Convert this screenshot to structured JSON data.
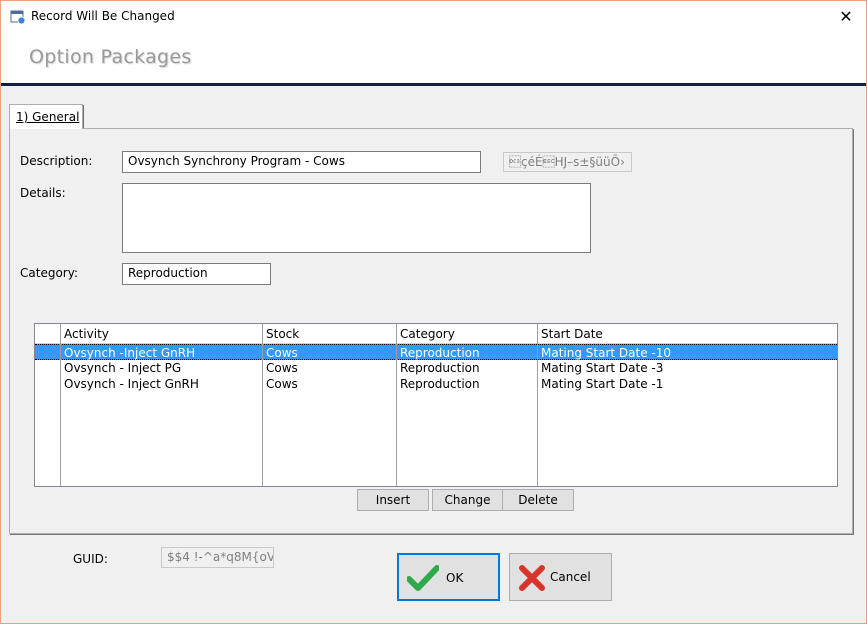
{
  "window": {
    "title": "Record Will Be Changed"
  },
  "header": {
    "title": "Option Packages"
  },
  "tabs": [
    {
      "label": "1) General"
    }
  ],
  "form": {
    "description_label": "Description:",
    "description_value": "Ovsynch Synchrony Program - Cows",
    "code_value": "\u0013çéÉ\u001bHJ–s±§üüÕ›",
    "details_label": "Details:",
    "details_value": "",
    "category_label": "Category:",
    "category_value": "Reproduction"
  },
  "grid": {
    "columns": [
      "Activity",
      "Stock",
      "Category",
      "Start Date"
    ],
    "rows": [
      {
        "activity": "Ovsynch -Inject GnRH",
        "stock": "Cows",
        "category": "Reproduction",
        "start": "Mating Start Date -10",
        "selected": true
      },
      {
        "activity": "Ovsynch - Inject PG",
        "stock": "Cows",
        "category": "Reproduction",
        "start": "Mating Start Date -3",
        "selected": false
      },
      {
        "activity": "Ovsynch - Inject GnRH",
        "stock": "Cows",
        "category": "Reproduction",
        "start": "Mating Start Date -1",
        "selected": false
      }
    ]
  },
  "grid_buttons": {
    "insert": "Insert",
    "change": "Change",
    "delete": "Delete"
  },
  "footer": {
    "guid_label": "GUID:",
    "guid_value": "$$4 !-^a*q8M{oV",
    "ok_label": "OK",
    "cancel_label": "Cancel"
  },
  "colors": {
    "selection": "#3399ff",
    "header_rule": "#0e2240",
    "ok_green": "#2eaa4a",
    "cancel_red": "#d9342b",
    "focus_border": "#0078d7"
  }
}
